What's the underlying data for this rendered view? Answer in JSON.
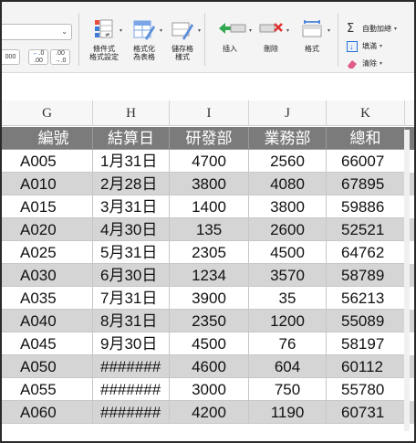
{
  "ribbon": {
    "number_format_options": [
      "000",
      ".0\n.00",
      ".00\n.0"
    ],
    "buttons": [
      {
        "label": "條件式\n格式設定"
      },
      {
        "label": "格式化\n為表格"
      },
      {
        "label": "儲存格\n樣式"
      },
      {
        "label": "插入"
      },
      {
        "label": "刪除"
      },
      {
        "label": "格式"
      }
    ],
    "editing": {
      "autosum_label": "自動加總",
      "fill_label": "填滿",
      "clear_label": "清除"
    }
  },
  "columns": [
    "G",
    "H",
    "I",
    "J",
    "K"
  ],
  "table": {
    "headers": [
      "編號",
      "結算日",
      "研發部",
      "業務部",
      "總和"
    ],
    "rows": [
      [
        "A005",
        "1月31日",
        "4700",
        "2560",
        "66007"
      ],
      [
        "A010",
        "2月28日",
        "3800",
        "4080",
        "67895"
      ],
      [
        "A015",
        "3月31日",
        "1400",
        "3800",
        "59886"
      ],
      [
        "A020",
        "4月30日",
        "135",
        "2600",
        "52521"
      ],
      [
        "A025",
        "5月31日",
        "2305",
        "4500",
        "64762"
      ],
      [
        "A030",
        "6月30日",
        "1234",
        "3570",
        "58789"
      ],
      [
        "A035",
        "7月31日",
        "3900",
        "35",
        "56213"
      ],
      [
        "A040",
        "8月31日",
        "2350",
        "1200",
        "55089"
      ],
      [
        "A045",
        "9月30日",
        "4500",
        "76",
        "58197"
      ],
      [
        "A050",
        "#######",
        "4600",
        "604",
        "60112"
      ],
      [
        "A055",
        "#######",
        "3000",
        "750",
        "55780"
      ],
      [
        "A060",
        "#######",
        "4200",
        "1190",
        "60731"
      ]
    ]
  },
  "colors": {
    "header_fill": "#7b7b7b",
    "band_fill": "#d5d5d6",
    "autosum_accent": "#333333",
    "fill_accent": "#2b6fd6",
    "clear_accent": "#e05a8a"
  }
}
